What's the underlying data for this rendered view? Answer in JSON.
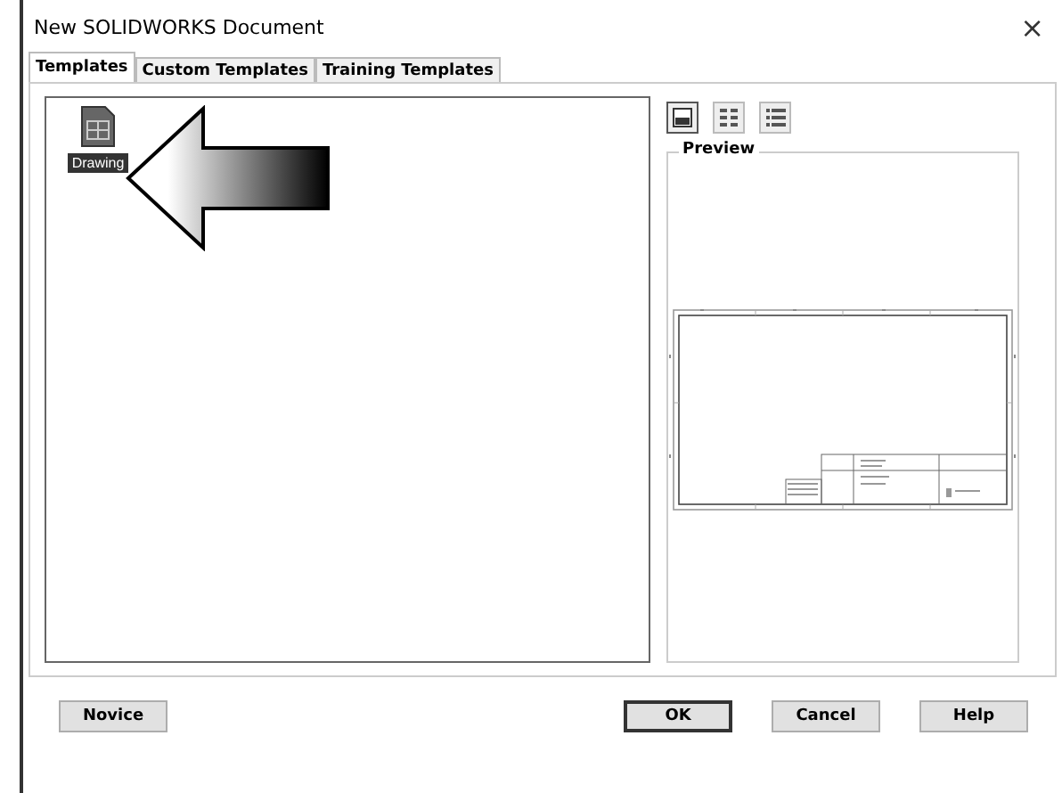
{
  "window": {
    "title": "New SOLIDWORKS Document",
    "close": "×"
  },
  "tabs": [
    {
      "label": "Templates",
      "selected": true
    },
    {
      "label": "Custom Templates",
      "selected": false
    },
    {
      "label": "Training Templates",
      "selected": false
    }
  ],
  "templates": [
    {
      "label": "Drawing",
      "selected": true
    }
  ],
  "view_buttons": [
    {
      "kind": "large",
      "selected": true
    },
    {
      "kind": "icons",
      "selected": false
    },
    {
      "kind": "list",
      "selected": false
    }
  ],
  "preview": {
    "label": "Preview"
  },
  "buttons": [
    {
      "label": "Novice",
      "default": false
    },
    {
      "label": "OK",
      "default": true
    },
    {
      "label": "Cancel",
      "default": false
    },
    {
      "label": "Help",
      "default": false
    }
  ]
}
